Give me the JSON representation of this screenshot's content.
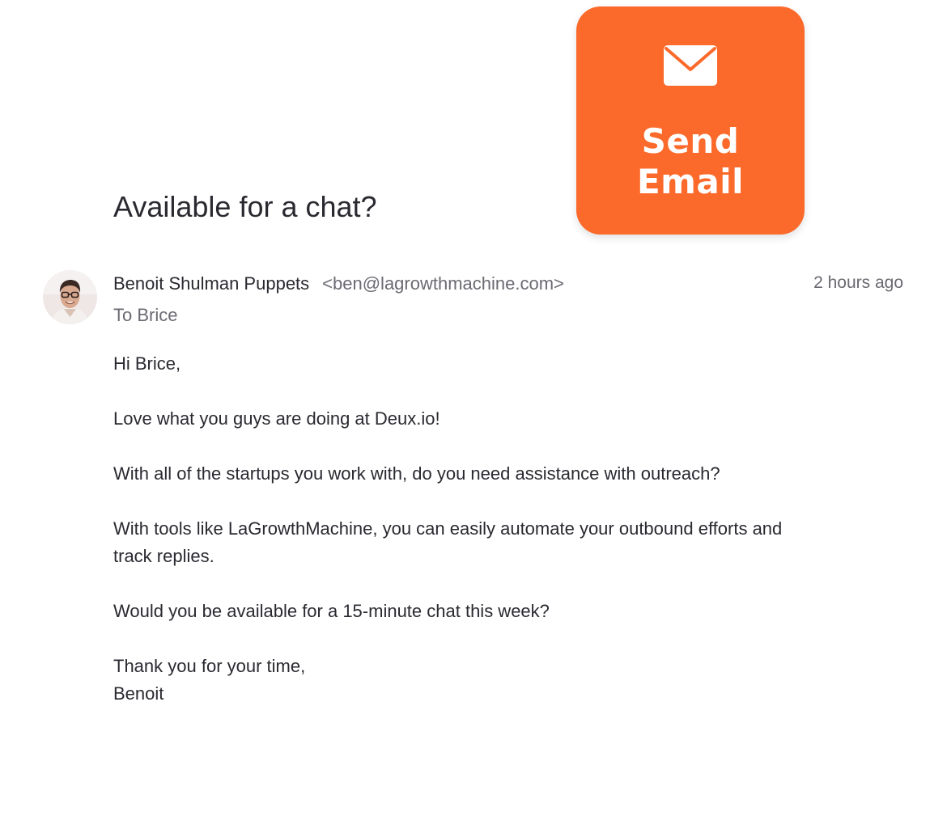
{
  "action_card": {
    "icon": "envelope-icon",
    "label_line1": "Send",
    "label_line2": "Email",
    "color": "#fb6a2b"
  },
  "email": {
    "subject": "Available for a chat?",
    "sender_name": "Benoit Shulman Puppets",
    "sender_email": "<ben@lagrowthmachine.com>",
    "timestamp": "2 hours ago",
    "recipient": "To Brice",
    "body": {
      "greeting": "Hi Brice,",
      "p1": "Love what you guys are doing at Deux.io!",
      "p2": "With all of the startups you work with, do you need assistance with outreach?",
      "p3_line1": "With tools like LaGrowthMachine, you can easily automate your outbound efforts and",
      "p3_line2": "track replies.",
      "p4": "Would you be available for a 15-minute chat this week?",
      "closing": "Thank you for your time,",
      "signature": "Benoit"
    }
  }
}
